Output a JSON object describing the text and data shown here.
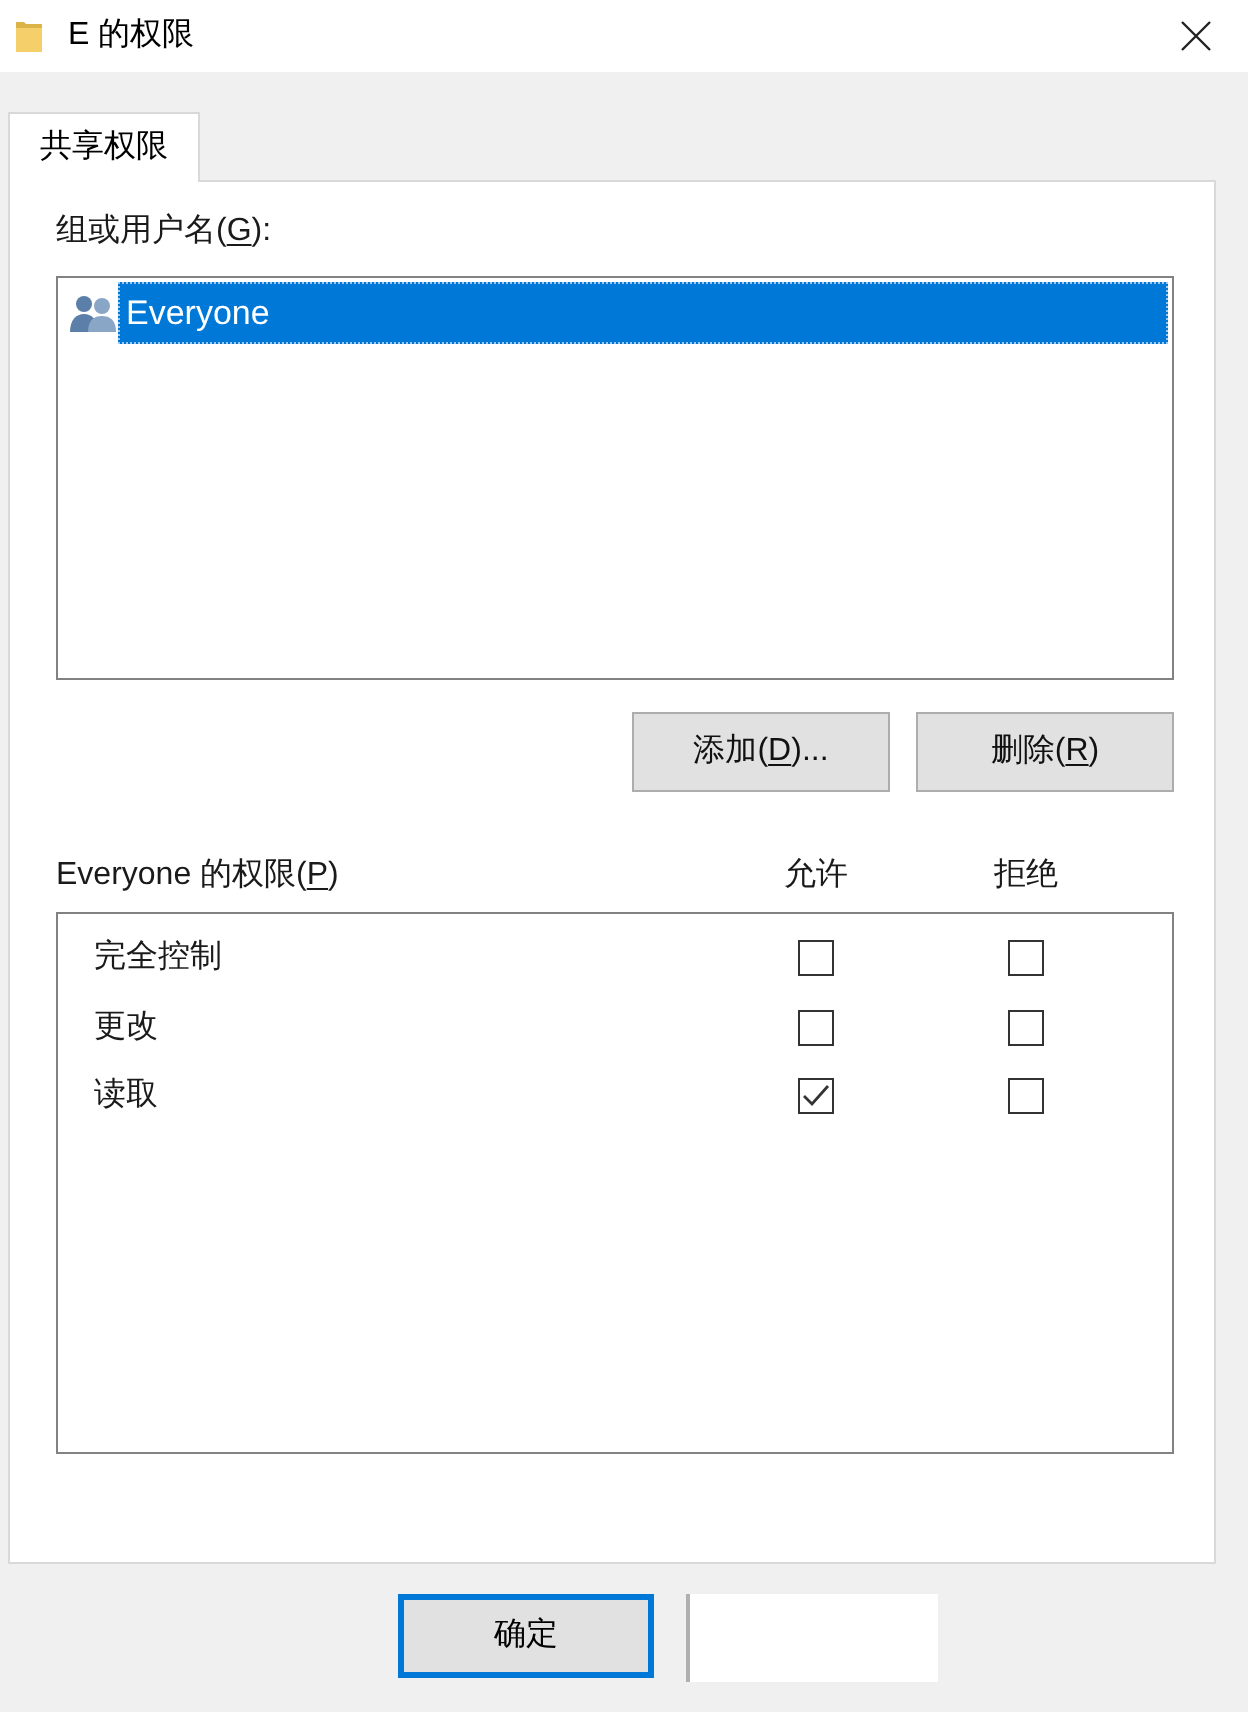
{
  "window": {
    "title": "E 的权限"
  },
  "tabs": [
    {
      "label": "共享权限",
      "selected": true
    }
  ],
  "group_list": {
    "label_parts": [
      {
        "text": "组或用户名(",
        "underline": false
      },
      {
        "text": "G",
        "underline": true
      },
      {
        "text": "):",
        "underline": false
      }
    ],
    "items": [
      {
        "name": "Everyone",
        "selected": true
      }
    ]
  },
  "list_buttons": [
    {
      "label_parts": [
        {
          "text": "添加(",
          "underline": false
        },
        {
          "text": "D",
          "underline": true
        },
        {
          "text": ")...",
          "underline": false
        }
      ]
    },
    {
      "label_parts": [
        {
          "text": "删除(",
          "underline": false
        },
        {
          "text": "R",
          "underline": true
        },
        {
          "text": ")",
          "underline": false
        }
      ]
    }
  ],
  "permissions": {
    "label_parts": [
      {
        "text": "Everyone 的权限(",
        "underline": false
      },
      {
        "text": "P",
        "underline": true
      },
      {
        "text": ")",
        "underline": false
      }
    ],
    "columns": [
      "允许",
      "拒绝"
    ],
    "rows": [
      {
        "name": "完全控制",
        "allow": false,
        "deny": false
      },
      {
        "name": "更改",
        "allow": false,
        "deny": false
      },
      {
        "name": "读取",
        "allow": true,
        "deny": false
      }
    ]
  },
  "footer_buttons": [
    {
      "kind": "default",
      "label": "确定"
    },
    {
      "kind": "covered"
    }
  ]
}
